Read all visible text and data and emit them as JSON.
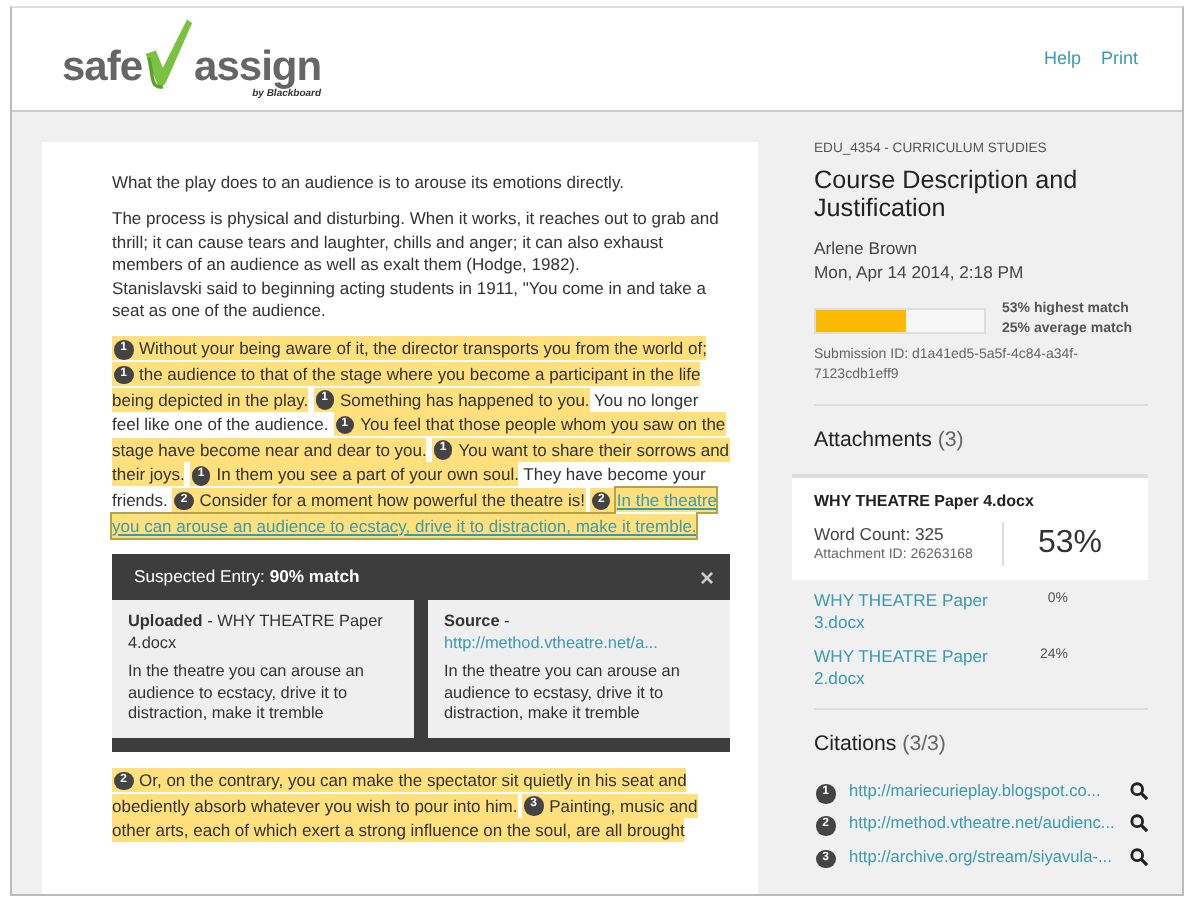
{
  "header": {
    "logo": {
      "word_1": "safe",
      "word_2": "assign",
      "byline": "by Blackboard"
    },
    "links": [
      "Help",
      "Print"
    ]
  },
  "document": {
    "blocks": [
      {
        "kind": "text",
        "text": "What the play does to an audience is to arouse its emotions directly."
      },
      {
        "kind": "text",
        "text": "The process is physical and disturbing. When it works, it reaches out to grab and thrill; it can cause tears and laughter, chills and anger; it can also exhaust members of an audience as well as exalt them (Hodge, 1982).\nStanislavski said to beginning acting students in 1911, \"You come in and take a seat as one of the audience."
      },
      {
        "kind": "passage",
        "segments": [
          {
            "citation": "1",
            "text": "Without your being aware of it, the director transports you from the world of;",
            "highlighted": true,
            "selected": false
          },
          {
            "citation": "1",
            "text": "the audience to that of the stage where you become a participant in the life being depicted in the play.",
            "highlighted": true,
            "selected": false
          },
          {
            "citation": "1",
            "text": "Something has happened to you.",
            "highlighted": true,
            "selected": false
          },
          {
            "text": "You no longer feel like one of the audience.",
            "highlighted": false,
            "selected": false
          },
          {
            "citation": "1",
            "text": "You feel that those people whom you saw on the stage have become near and dear to you.",
            "highlighted": true,
            "selected": false
          },
          {
            "citation": "1",
            "text": "You want to share their sorrows and their joys.",
            "highlighted": true,
            "selected": false
          },
          {
            "citation": "1",
            "text": "In them you see a part of your own soul.",
            "highlighted": true,
            "selected": false
          },
          {
            "text": "They have become your friends.",
            "highlighted": false,
            "selected": false
          },
          {
            "citation": "2",
            "text": "Consider for a moment how powerful the theatre is!",
            "highlighted": true,
            "selected": false
          },
          {
            "citation": "2",
            "text": "In the theatre you can arouse an audience to ecstacy, drive it to distraction, make it tremble.",
            "highlighted": true,
            "selected": true
          }
        ]
      },
      {
        "kind": "popup",
        "title": "Suspected Entry: **90% match**",
        "close": "×",
        "panels": [
          {
            "heading": "**Uploaded** - WHY THEATRE Paper 4.docx",
            "excerpt": "In the theatre you can arouse an audience to ecstacy, drive it to distraction, make it tremble"
          },
          {
            "heading": "**Source** -",
            "link": "http://method.vtheatre.net/a...",
            "excerpt": "In the theatre you can arouse an audience to ecstasy, drive it to distraction, make it tremble"
          }
        ]
      },
      {
        "kind": "passage",
        "segments": [
          {
            "citation": "2",
            "text": "Or, on the contrary, you can make the spectator sit quietly in his seat and obediently absorb whatever you wish to pour into him.",
            "highlighted": true,
            "selected": false
          },
          {
            "citation": "3",
            "text": "Painting, music and other arts, each of which exert a strong influence on the soul, are all brought",
            "highlighted": true,
            "selected": false
          }
        ]
      }
    ]
  },
  "sidebar": {
    "course": "EDU_4354 - CURRICULUM STUDIES",
    "title": "Course Description and Justification",
    "author": "Arlene Brown",
    "date": "Mon, Apr 14 2014, 2:18 PM",
    "match": {
      "level": 0.53,
      "highest": "53% highest match",
      "average": "25% average match"
    },
    "submission_id": "Submission ID: d1a41ed5-5a5f-4c84-a34f-7123cdb1eff9",
    "attachments_heading": "Attachments",
    "attachments_count": "(3)",
    "attachments": [
      {
        "name": "WHY THEATRE Paper 4.docx",
        "percent": "53%",
        "selected": true,
        "word_count": "Word Count: 325",
        "attachment_id": "Attachment ID: 26263168"
      },
      {
        "name": "WHY THEATRE Paper 3.docx",
        "percent": "0%",
        "selected": false
      },
      {
        "name": "WHY THEATRE Paper 2.docx",
        "percent": "24%",
        "selected": false
      }
    ],
    "citations_heading": "Citations",
    "citations_count": "(3/3)",
    "citations": [
      {
        "number": "1",
        "url": "http://mariecurieplay.blogspot.co..."
      },
      {
        "number": "2",
        "url": "http://method.vtheatre.net/audienc..."
      },
      {
        "number": "3",
        "url": "http://archive.org/stream/siyavula-..."
      }
    ]
  }
}
